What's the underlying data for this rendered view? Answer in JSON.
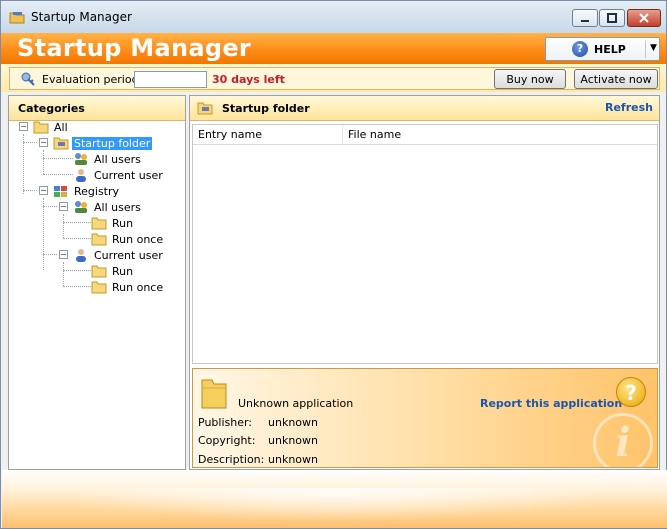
{
  "window": {
    "title": "Startup Manager"
  },
  "header": {
    "app_title": "Startup Manager",
    "help_label": "HELP"
  },
  "evaluation": {
    "label": "Evaluation period:",
    "input_value": "",
    "days_left": "30 days left",
    "buy_label": "Buy now",
    "activate_label": "Activate now"
  },
  "categories": {
    "title": "Categories",
    "tree": {
      "all": "All",
      "startup_folder": "Startup folder",
      "startup_all_users": "All users",
      "startup_current_user": "Current user",
      "registry": "Registry",
      "reg_all_users": "All users",
      "reg_all_run": "Run",
      "reg_all_run_once": "Run once",
      "reg_current_user": "Current user",
      "reg_cu_run": "Run",
      "reg_cu_run_once": "Run once"
    }
  },
  "main": {
    "title": "Startup folder",
    "refresh_label": "Refresh",
    "columns": [
      "Entry name",
      "File name"
    ]
  },
  "info": {
    "app_name": "Unknown application",
    "report_label": "Report this application",
    "publisher_label": "Publisher:",
    "publisher_value": "unknown",
    "copyright_label": "Copyright:",
    "copyright_value": "unknown",
    "description_label": "Description:",
    "description_value": "unknown"
  },
  "colors": {
    "accent_orange": "#ff8c1a",
    "link_blue": "#1a56b0",
    "warning_red": "#c0202a",
    "selection_blue": "#3399ff"
  }
}
